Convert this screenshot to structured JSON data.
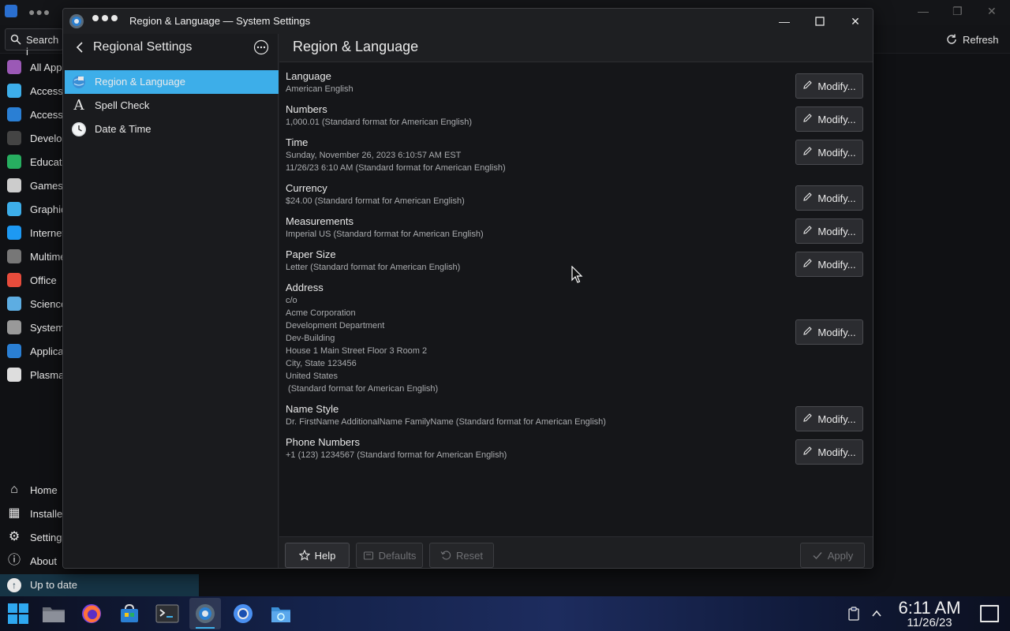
{
  "background_app": {
    "search_label": "Search i",
    "refresh_label": "Refresh",
    "categories": [
      {
        "label": "All Apps",
        "color": "#9b59b6"
      },
      {
        "label": "Accessibility",
        "color": "#3daee9"
      },
      {
        "label": "Accessories",
        "color": "#2a7fd4"
      },
      {
        "label": "Development",
        "color": "#444"
      },
      {
        "label": "Education",
        "color": "#27ae60"
      },
      {
        "label": "Games",
        "color": "#ccc"
      },
      {
        "label": "Graphics",
        "color": "#3daee9"
      },
      {
        "label": "Internet",
        "color": "#1d99f3"
      },
      {
        "label": "Multimedia",
        "color": "#777"
      },
      {
        "label": "Office",
        "color": "#e74c3c"
      },
      {
        "label": "Science",
        "color": "#5dade2"
      },
      {
        "label": "System",
        "color": "#999"
      },
      {
        "label": "Application",
        "color": "#2a7fd4"
      },
      {
        "label": "Plasma",
        "color": "#ddd"
      }
    ],
    "bottom_items": [
      {
        "label": "Home"
      },
      {
        "label": "Installed"
      },
      {
        "label": "Settings"
      },
      {
        "label": "About"
      }
    ],
    "update_status": "Up to date"
  },
  "window": {
    "title": "Region & Language — System Settings"
  },
  "nav": {
    "title": "Regional Settings",
    "items": [
      {
        "label": "Region & Language",
        "active": true
      },
      {
        "label": "Spell Check",
        "active": false
      },
      {
        "label": "Date & Time",
        "active": false
      }
    ]
  },
  "content": {
    "title": "Region & Language",
    "modify_label": "Modify...",
    "settings": [
      {
        "name": "Language",
        "value": "American English"
      },
      {
        "name": "Numbers",
        "value": "1,000.01 (Standard format for American English)"
      },
      {
        "name": "Time",
        "value": "Sunday, November 26, 2023 6:10:57 AM EST\n11/26/23 6:10 AM (Standard format for American English)"
      },
      {
        "name": "Currency",
        "value": "$24.00 (Standard format for American English)"
      },
      {
        "name": "Measurements",
        "value": "Imperial US (Standard format for American English)"
      },
      {
        "name": "Paper Size",
        "value": "Letter (Standard format for American English)"
      },
      {
        "name": "Address",
        "value": "c/o\nAcme Corporation\nDevelopment Department\nDev-Building\nHouse 1 Main Street Floor 3 Room 2\nCity, State 123456\nUnited States\n (Standard format for American English)"
      },
      {
        "name": "Name Style",
        "value": "Dr. FirstName AdditionalName FamilyName (Standard format for American English)"
      },
      {
        "name": "Phone Numbers",
        "value": "+1 (123) 1234567 (Standard format for American English)"
      }
    ],
    "footer": {
      "help": "Help",
      "defaults": "Defaults",
      "reset": "Reset",
      "apply": "Apply"
    }
  },
  "taskbar": {
    "time": "6:11 AM",
    "date": "11/26/23"
  }
}
